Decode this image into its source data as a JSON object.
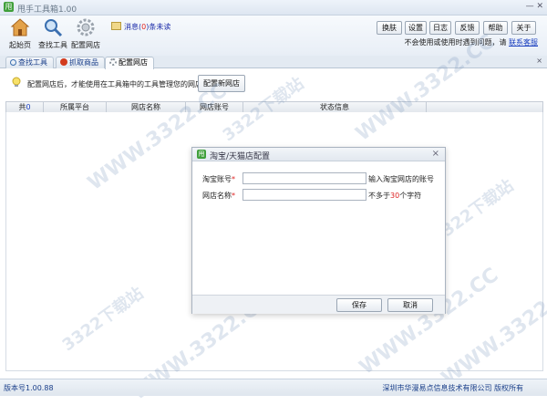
{
  "app": {
    "title": "甩手工具箱1.00",
    "icon_letter": "甩"
  },
  "window_controls": "— ✕",
  "toolbar": {
    "tools": [
      {
        "label": "起始页",
        "icon": "home-icon"
      },
      {
        "label": "查找工具",
        "icon": "search-icon"
      },
      {
        "label": "配置网店",
        "icon": "gear-icon"
      }
    ],
    "message_prefix": "消息(",
    "message_count": "0",
    "message_suffix": ")条未读",
    "buttons": [
      "换肤",
      "设置",
      "日志",
      "反馈",
      "帮助",
      "关于"
    ],
    "help_text": "不会使用或使用时遇到问题，请",
    "help_link": "联系客服"
  },
  "tabs": {
    "items": [
      {
        "label": "查找工具",
        "icon": "search-icon"
      },
      {
        "label": "抓取商品",
        "icon": "grab-icon"
      },
      {
        "label": "配置网店",
        "icon": "gear-icon",
        "active": true
      }
    ],
    "close": "×"
  },
  "notice": {
    "text": "配置网店后，才能使用在工具箱中的工具管理您的网店",
    "button": "配置新网店"
  },
  "table": {
    "count_label": "共",
    "count_value": "0",
    "columns": [
      "所属平台",
      "网店名称",
      "网店账号",
      "状态信息"
    ]
  },
  "status": {
    "version": "版本号1.00.88",
    "copyright": "深圳市华漫易点信息技术有限公司 版权所有"
  },
  "watermark": {
    "text": "WWW.3322.CC",
    "text2": "3322下载站"
  },
  "dialog": {
    "title": "淘宝/天猫店配置",
    "close": "×",
    "fields": [
      {
        "label": "淘宝账号",
        "required_mark": "*",
        "value": "",
        "hint": "输入淘宝网店的账号"
      },
      {
        "label": "网店名称",
        "required_mark": "*",
        "value": ""
      }
    ],
    "name_hint_prefix": "不多于",
    "name_hint_num": "30",
    "name_hint_suffix": "个字符",
    "save": "保存",
    "cancel": "取消"
  },
  "colors": {
    "accent": "#1a3f8a",
    "required": "#dd2222",
    "brand_green": "#3f9f3a"
  }
}
